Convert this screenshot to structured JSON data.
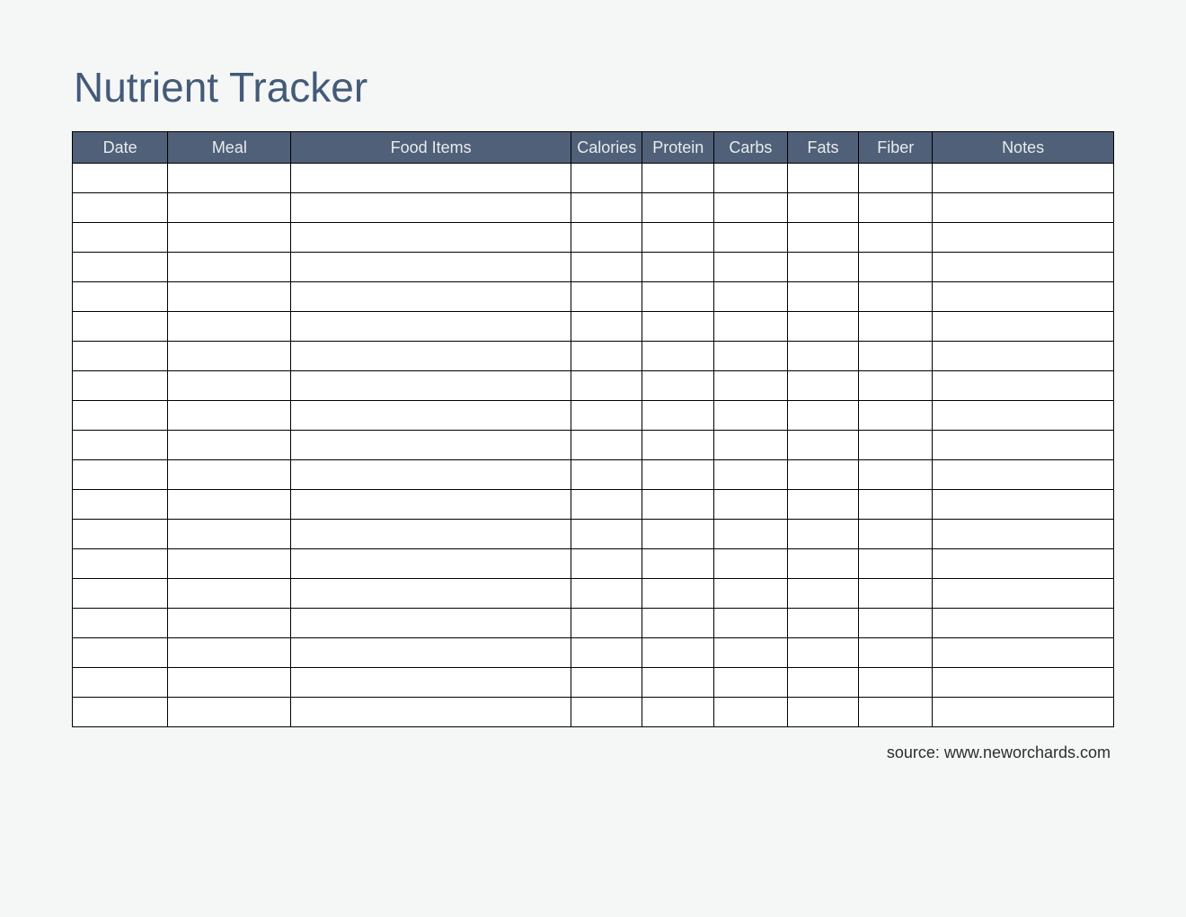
{
  "title": "Nutrient Tracker",
  "columns": [
    "Date",
    "Meal",
    "Food Items",
    "Calories",
    "Protein",
    "Carbs",
    "Fats",
    "Fiber",
    "Notes"
  ],
  "row_count": 19,
  "source_label": "source: www.neworchards.com",
  "colors": {
    "header_bg": "#4f6078",
    "header_text": "#e8ecf0",
    "title_text": "#445a78",
    "page_bg": "#f5f7f7"
  }
}
